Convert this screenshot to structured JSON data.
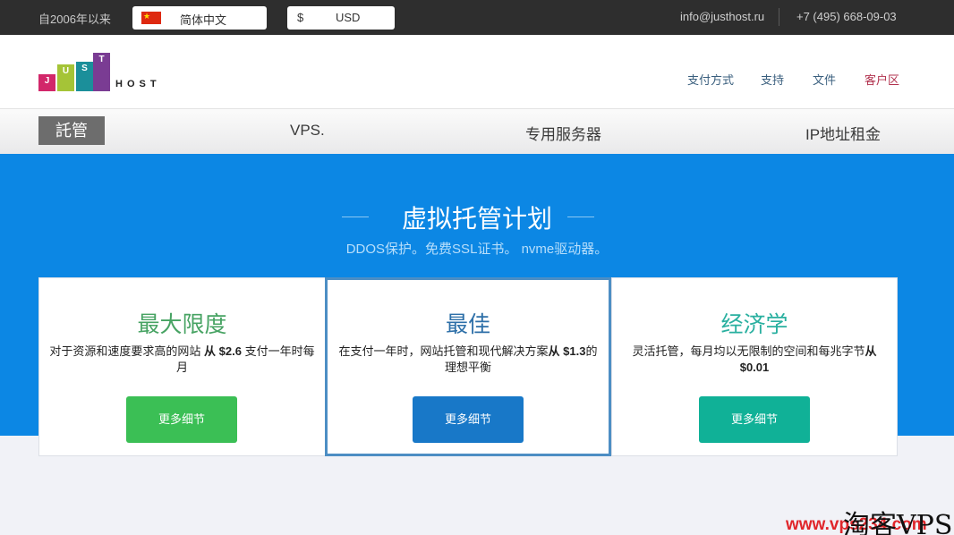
{
  "topbar": {
    "since": "自2006年以来",
    "language": "简体中文",
    "currency_symbol": "$",
    "currency": "USD",
    "email": "info@justhost.ru",
    "phone": "+7 (495) 668-09-03"
  },
  "logo": {
    "letters": [
      "J",
      "U",
      "S",
      "T"
    ],
    "host": "HOST",
    "colors": [
      "#d2276a",
      "#a5c437",
      "#1b8f9a",
      "#7a3c93"
    ]
  },
  "header_links": [
    "支付方式",
    "支持",
    "文件",
    "客户区"
  ],
  "nav": [
    "託管",
    "VPS.",
    "专用服务器",
    "IP地址租金"
  ],
  "hero": {
    "title": "虚拟托管计划",
    "subtitle": "DDOS保护。免费SSL证书。 nvme驱动器。"
  },
  "cards": [
    {
      "title": "最大限度",
      "title_color": "#47a363",
      "desc_before": "对于资源和速度要求高的网站 ",
      "desc_price": "从 $2.6",
      "desc_after": " 支付一年时每月",
      "button": "更多细节",
      "button_color": "#3bbf55"
    },
    {
      "title": "最佳",
      "title_color": "#2d6fa8",
      "desc_before": "在支付一年时，网站托管和现代解决方案",
      "desc_price": "从 $1.3",
      "desc_after": "的理想平衡",
      "button": "更多细节",
      "button_color": "#1878c8"
    },
    {
      "title": "经济学",
      "title_color": "#2ab0a0",
      "desc_before": "灵活托管，每月均以无限制的空间和每兆字节",
      "desc_price": "从 $0.01",
      "desc_after": "",
      "button": "更多细节",
      "button_color": "#10b197"
    }
  ],
  "watermark": {
    "url": "www.vps234.com",
    "brand": "淘客VPS"
  }
}
